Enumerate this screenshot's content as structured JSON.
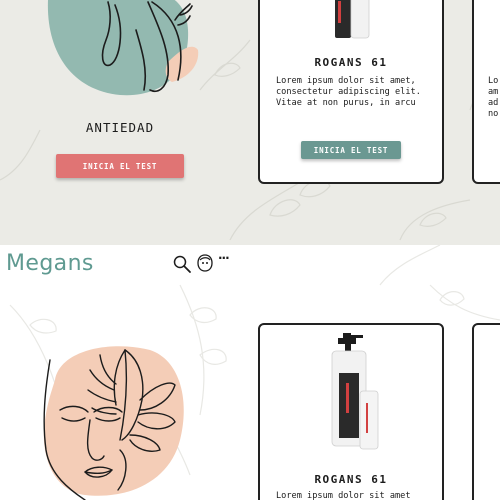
{
  "colors": {
    "brand": "#5f9a91",
    "accent_teal": "#6b9892",
    "accent_coral": "#e07474",
    "blob_teal": "#93b9b0",
    "blob_peach": "#f4cdb7",
    "line": "#1c1c1c"
  },
  "top_screen": {
    "category_title": "ANTIEDAD",
    "test_button_label": "INICIA EL TEST",
    "product_card": {
      "name": "ROGANS 61",
      "description": "Lorem ipsum dolor sit amet, consectetur adipiscing elit. Vitae at non purus, in arcu",
      "button_label": "INICIA EL TEST"
    },
    "partial_card_text": "Lo\nam\nad\nno"
  },
  "bottom_screen": {
    "header": {
      "brand": "Megans",
      "icons": [
        "search-icon",
        "face-icon",
        "more-icon"
      ],
      "more_glyph": "···"
    },
    "product_card": {
      "name": "ROGANS 61",
      "description": "Lorem ipsum dolor sit amet"
    }
  }
}
